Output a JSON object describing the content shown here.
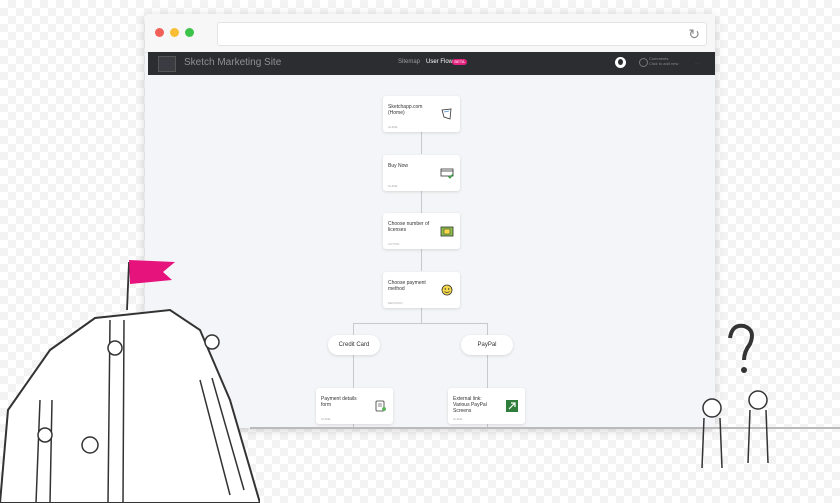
{
  "app": {
    "title": "Sketch Marketing Site"
  },
  "nav": {
    "tabs": [
      "Sitemap",
      "User Flow"
    ],
    "badge": "BETA"
  },
  "header": {
    "comments_line1": "Comments",
    "comments_line2": "Click to add new"
  },
  "flow": {
    "pages": [
      {
        "title": "Sketchapp.com (Home)",
        "tag": "GUIDE",
        "icon": "mirror-icon"
      },
      {
        "title": "Buy Now",
        "tag": "GUIDE",
        "icon": "credit-card-check-icon"
      },
      {
        "title": "Choose number of licenses",
        "tag": "ACTION",
        "icon": "license-count-icon"
      },
      {
        "title": "Choose payment method",
        "tag": "DECISION",
        "icon": "smiley-icon"
      },
      {
        "title": "Payment details form",
        "tag": "GUIDE",
        "icon": "form-icon"
      },
      {
        "title": "External link: Various PayPal Screens",
        "tag": "GUIDE",
        "icon": "external-link-icon"
      }
    ],
    "branches": [
      "Credit Card",
      "PayPal"
    ]
  },
  "colors": {
    "accent": "#e1237e",
    "appbar": "#2b2d31",
    "canvas": "#f4f5f8",
    "flag": "#e6137d",
    "link_icon": "#2f7d3a"
  }
}
